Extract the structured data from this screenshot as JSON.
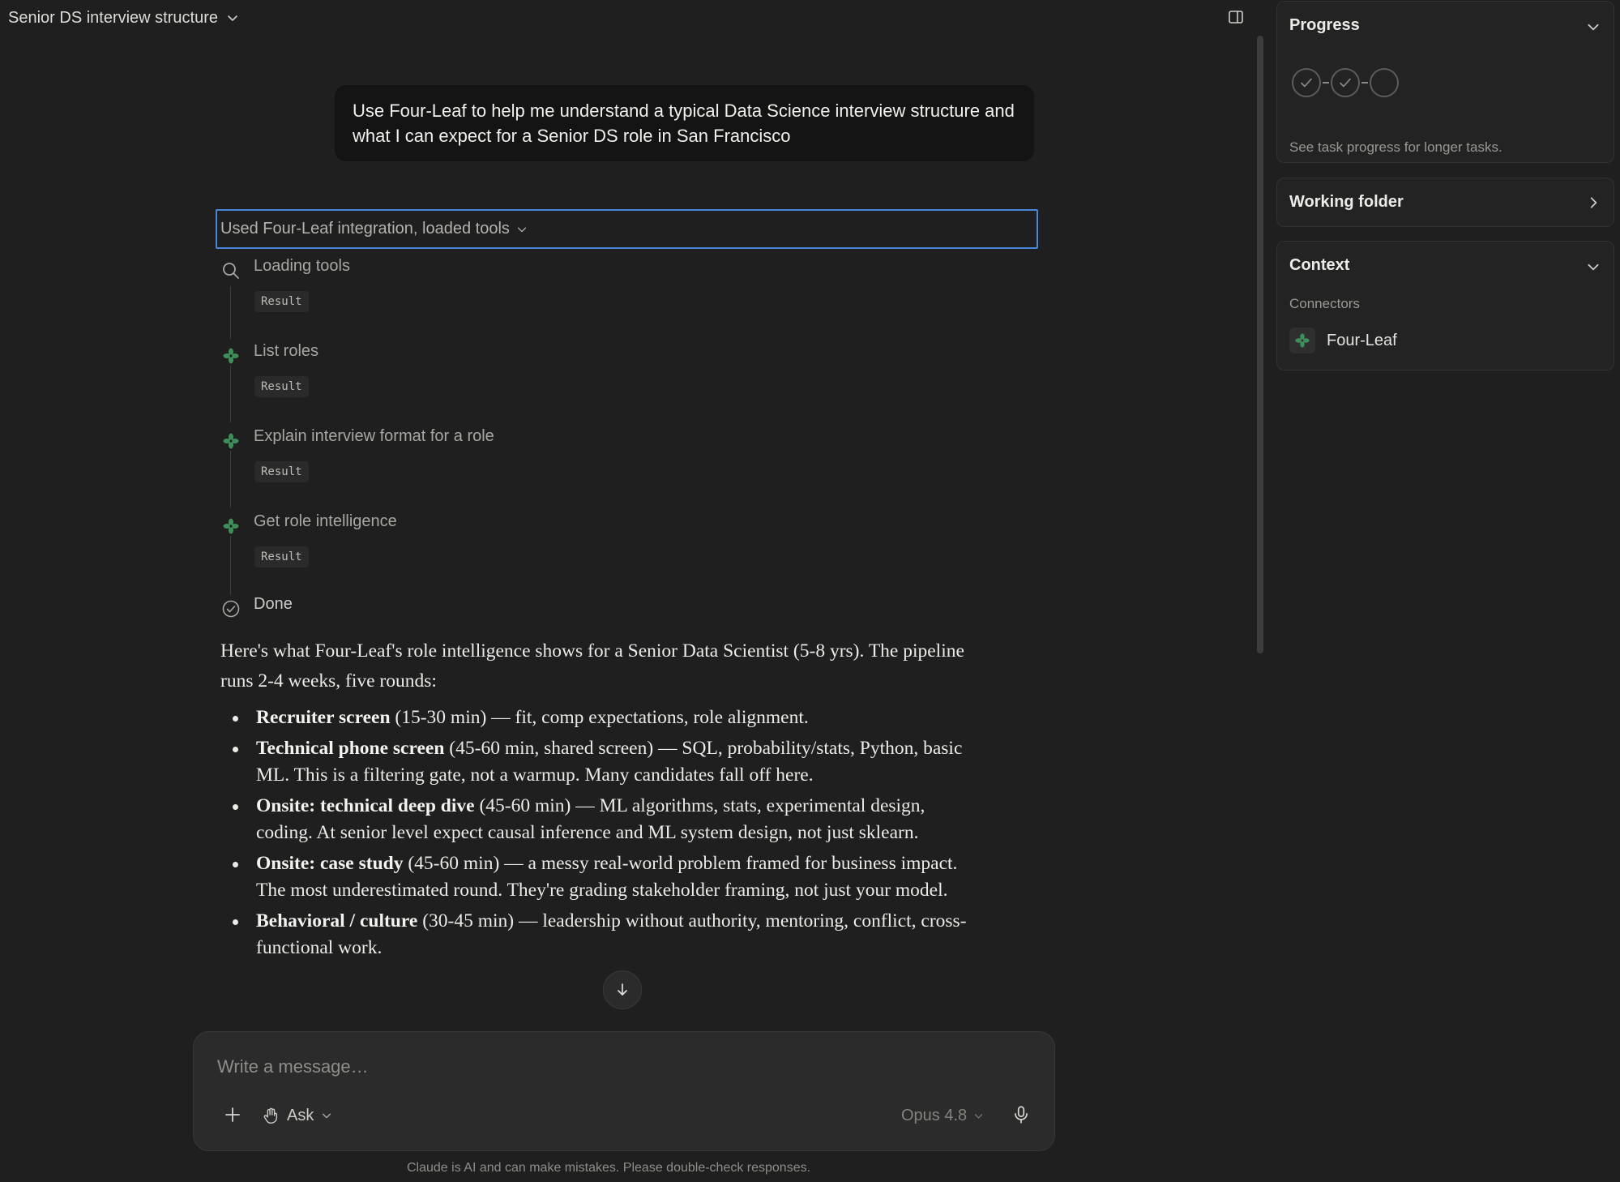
{
  "header": {
    "title": "Senior DS interview structure"
  },
  "conversation": {
    "user_message": "Use Four-Leaf to help me understand a typical Data Science interview structure and what I can expect for a Senior DS role in San Francisco",
    "tools_summary": "Used Four-Leaf integration, loaded tools",
    "steps": [
      {
        "label": "Loading tools",
        "result": "Result",
        "icon": "search-icon"
      },
      {
        "label": "List roles",
        "result": "Result",
        "icon": "four-leaf-icon"
      },
      {
        "label": "Explain interview format for a role",
        "result": "Result",
        "icon": "four-leaf-icon"
      },
      {
        "label": "Get role intelligence",
        "result": "Result",
        "icon": "four-leaf-icon"
      }
    ],
    "done_label": "Done",
    "answer": {
      "intro": "Here's what Four-Leaf's role intelligence shows for a Senior Data Scientist (5-8 yrs). The pipeline runs 2-4 weeks, five rounds:",
      "rounds": [
        {
          "title": "Recruiter screen",
          "detail": " (15-30 min) — fit, comp expectations, role alignment."
        },
        {
          "title": "Technical phone screen",
          "detail": " (45-60 min, shared screen) — SQL, probability/stats, Python, basic ML. This is a filtering gate, not a warmup. Many candidates fall off here."
        },
        {
          "title": "Onsite: technical deep dive",
          "detail": " (45-60 min) — ML algorithms, stats, experimental design, coding. At senior level expect causal inference and ML system design, not just sklearn."
        },
        {
          "title": "Onsite: case study",
          "detail": " (45-60 min) — a messy real-world problem framed for business impact. The most underestimated round. They're grading stakeholder framing, not just your model."
        },
        {
          "title": "Behavioral / culture",
          "detail": " (30-45 min) — leadership without authority, mentoring, conflict, cross-functional work."
        }
      ]
    }
  },
  "composer": {
    "placeholder": "Write a message…",
    "mode_label": "Ask",
    "model_label": "Opus 4.8"
  },
  "disclaimer": "Claude is AI and can make mistakes. Please double-check responses.",
  "sidebar": {
    "progress": {
      "title": "Progress",
      "hint": "See task progress for longer tasks.",
      "completed_steps": 2,
      "total_steps": 3
    },
    "working_folder": {
      "title": "Working folder"
    },
    "context": {
      "title": "Context",
      "connectors_label": "Connectors",
      "connectors": [
        {
          "name": "Four-Leaf",
          "icon": "four-leaf-icon"
        }
      ]
    }
  },
  "colors": {
    "background": "#1f1f1f",
    "focus_outline": "#4a86d8",
    "four_leaf_green": "#3f8f5a"
  }
}
